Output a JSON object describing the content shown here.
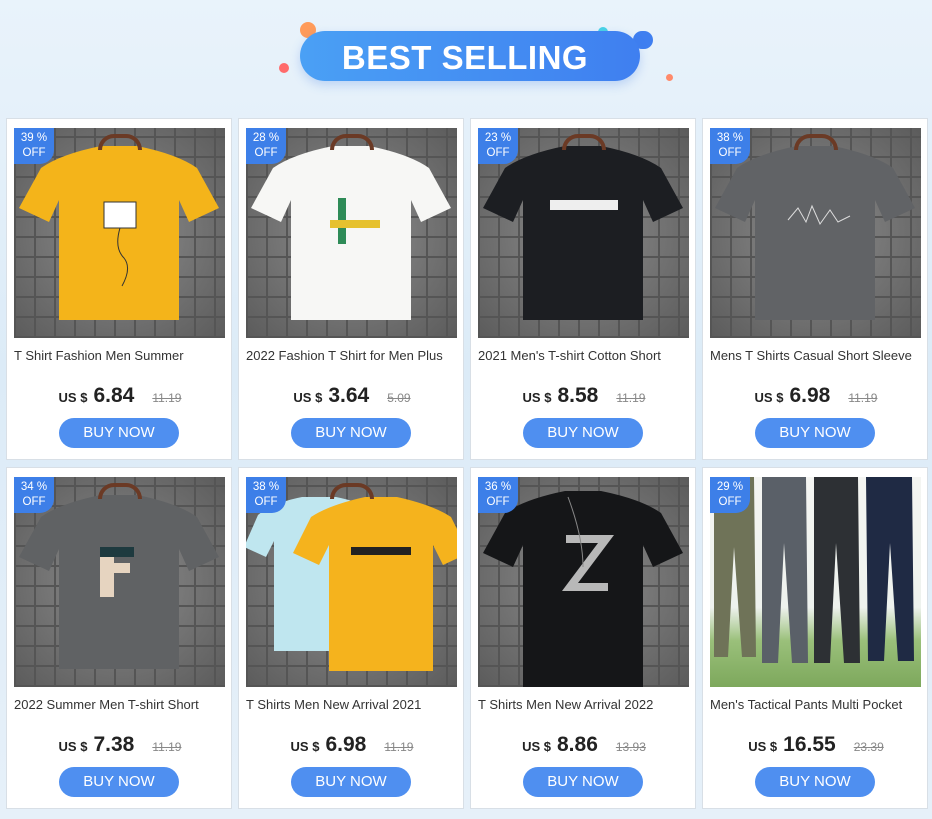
{
  "banner": {
    "title": "BEST SELLING"
  },
  "colors": {
    "accent": "#4f8ff0",
    "badge": "#3d7fe8"
  },
  "labels": {
    "currency": "US $",
    "off": "OFF",
    "buy": "BUY NOW"
  },
  "products": [
    {
      "discount": "39 %",
      "title": "T Shirt Fashion Men Summer",
      "price": "6.84",
      "original_price": "11.19",
      "image": "yellow-tshirt"
    },
    {
      "discount": "28 %",
      "title": "2022 Fashion T Shirt for Men Plus",
      "price": "3.64",
      "original_price": "5.09",
      "image": "white-tshirt"
    },
    {
      "discount": "23 %",
      "title": "2021 Men's T-shirt Cotton Short",
      "price": "8.58",
      "original_price": "11.19",
      "image": "black-tshirt"
    },
    {
      "discount": "38 %",
      "title": "Mens T Shirts Casual Short Sleeve",
      "price": "6.98",
      "original_price": "11.19",
      "image": "gray-tshirt"
    },
    {
      "discount": "34 %",
      "title": "2022 Summer Men T-shirt Short",
      "price": "7.38",
      "original_price": "11.19",
      "image": "gray-f-tshirt"
    },
    {
      "discount": "38 %",
      "title": "T Shirts Men New Arrival 2021",
      "price": "6.98",
      "original_price": "11.19",
      "image": "blue-yellow-tshirts"
    },
    {
      "discount": "36 %",
      "title": "T Shirts Men New Arrival 2022",
      "price": "8.86",
      "original_price": "13.93",
      "image": "black-z-tshirt"
    },
    {
      "discount": "29 %",
      "title": "Men's Tactical Pants Multi Pocket",
      "price": "16.55",
      "original_price": "23.39",
      "image": "tactical-pants"
    }
  ]
}
